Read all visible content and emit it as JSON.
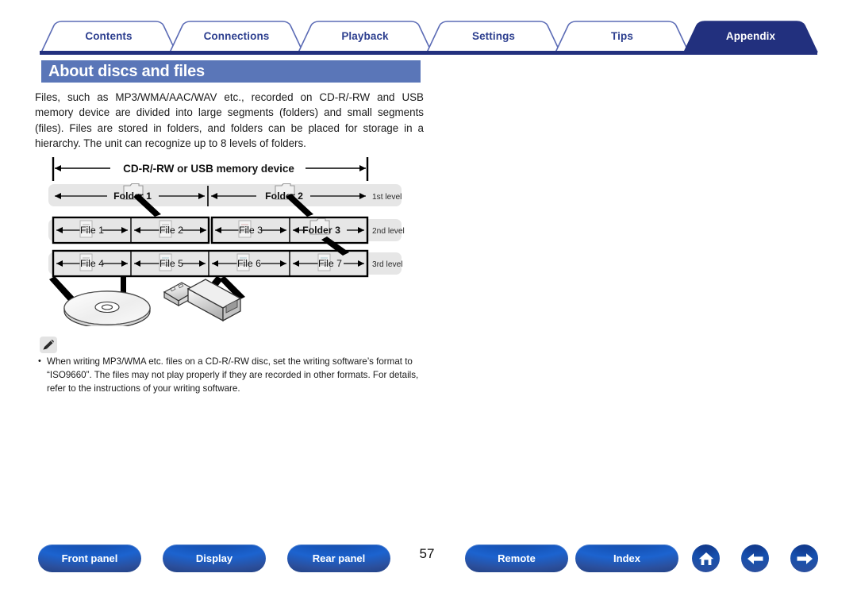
{
  "tabs": [
    {
      "label": "Contents",
      "active": false
    },
    {
      "label": "Connections",
      "active": false
    },
    {
      "label": "Playback",
      "active": false
    },
    {
      "label": "Settings",
      "active": false
    },
    {
      "label": "Tips",
      "active": false
    },
    {
      "label": "Appendix",
      "active": true
    }
  ],
  "heading": "About discs and files",
  "intro": "Files, such as MP3/WMA/AAC/WAV etc., recorded on CD-R/-RW and USB memory device are divided into large segments (folders) and small segments (files). Files are stored in folders, and folders can be placed for storage in a hierarchy. The unit can recognize up to 8 levels of folders.",
  "diagram": {
    "title": "CD-R/-RW or USB memory device",
    "levels": [
      {
        "label": "1st level",
        "cells": [
          {
            "text": "Folder 1",
            "icon": "folder-icon",
            "bold": true
          },
          {
            "text": "Folder 2",
            "icon": "folder-icon",
            "bold": true
          }
        ]
      },
      {
        "label": "2nd level",
        "cells": [
          {
            "text": "File 1",
            "icon": "file-icon",
            "bold": false
          },
          {
            "text": "File 2",
            "icon": "file-icon",
            "bold": false
          },
          {
            "text": "File 3",
            "icon": "file-icon",
            "bold": false
          },
          {
            "text": "Folder 3",
            "icon": "folder-icon",
            "bold": true
          }
        ]
      },
      {
        "label": "3rd level",
        "cells": [
          {
            "text": "File 4",
            "icon": "file-icon",
            "bold": false
          },
          {
            "text": "File 5",
            "icon": "file-icon",
            "bold": false
          },
          {
            "text": "File 6",
            "icon": "file-icon",
            "bold": false
          },
          {
            "text": "File 7",
            "icon": "file-icon",
            "bold": false
          }
        ]
      }
    ],
    "media": [
      {
        "name": "cd-disc-illustration"
      },
      {
        "name": "usb-memory-device-illustration"
      }
    ]
  },
  "note": {
    "icon": "pencil-icon",
    "bullet": "•",
    "text": "When writing MP3/WMA etc. files on a CD-R/-RW disc, set the writing software’s format to “ISO9660”. The files may not play properly if they are recorded in other formats. For details, refer to the instructions of your writing software."
  },
  "footer": {
    "page_number": "57",
    "left_buttons": [
      {
        "label": "Front panel"
      },
      {
        "label": "Display"
      },
      {
        "label": "Rear panel"
      }
    ],
    "right_buttons": [
      {
        "label": "Remote"
      },
      {
        "label": "Index"
      }
    ],
    "icon_buttons": [
      {
        "icon": "home-icon"
      },
      {
        "icon": "arrow-left-icon"
      },
      {
        "icon": "arrow-right-icon"
      }
    ]
  },
  "colors": {
    "tab_active_bg": "#22307e",
    "tab_inactive_text": "#2d3f8f",
    "tab_outline": "#5b6bb5",
    "heading_bg": "#5a76b8",
    "rule": "#22307e",
    "button_blue": "#1757bd",
    "level_band": "#e6e6e6"
  }
}
